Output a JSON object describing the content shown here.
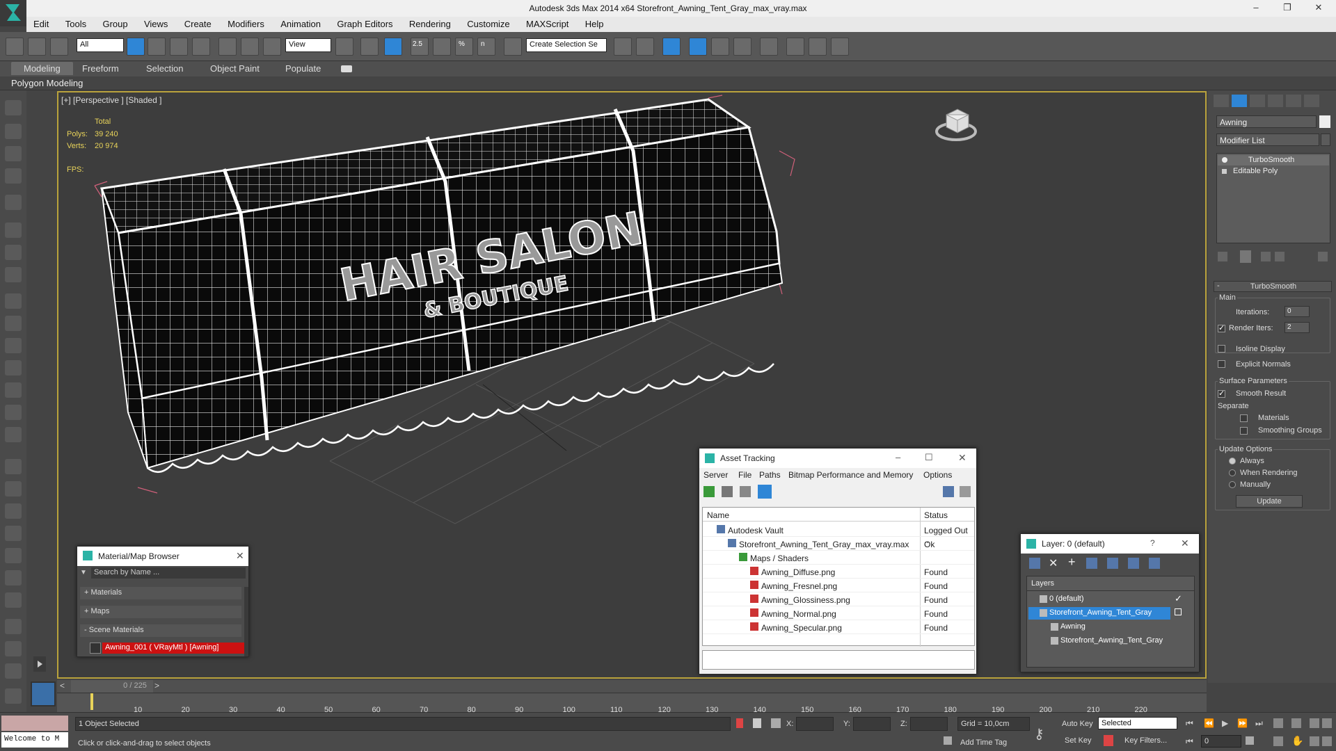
{
  "window": {
    "title": "Autodesk 3ds Max  2014 x64     Storefront_Awning_Tent_Gray_max_vray.max",
    "controls": [
      "–",
      "❐",
      "✕"
    ]
  },
  "menu": [
    "Edit",
    "Tools",
    "Group",
    "Views",
    "Create",
    "Modifiers",
    "Animation",
    "Graph Editors",
    "Rendering",
    "Customize",
    "MAXScript",
    "Help"
  ],
  "toolbar": {
    "filter_value": "All",
    "view_value": "View",
    "selection_set_placeholder": "Create Selection Se",
    "snap_labels": [
      "2.5",
      "%",
      "n"
    ]
  },
  "ribbon": {
    "tabs": [
      "Modeling",
      "Freeform",
      "Selection",
      "Object Paint",
      "Populate"
    ],
    "panel_label": "Polygon Modeling"
  },
  "viewport": {
    "label": "[+] [Perspective ] [Shaded ]",
    "stats_header": "Total",
    "polys_label": "Polys:",
    "polys_value": "39 240",
    "verts_label": "Verts:",
    "verts_value": "20 974",
    "fps_label": "FPS:",
    "sign_line1": "HAIR SALON",
    "sign_line2": "& BOUTIQUE"
  },
  "command_panel": {
    "object_name": "Awning",
    "modifier_list_label": "Modifier List",
    "stack": [
      "TurboSmooth",
      "Editable Poly"
    ],
    "rollout_title": "TurboSmooth",
    "main_group": "Main",
    "iterations_label": "Iterations:",
    "iterations_value": "0",
    "render_iters_label": "Render Iters:",
    "render_iters_value": "2",
    "render_iters_checked": true,
    "isoline_label": "Isoline Display",
    "explicit_normals_label": "Explicit Normals",
    "surface_params_group": "Surface Parameters",
    "smooth_result_label": "Smooth Result",
    "separate_label": "Separate",
    "materials_label": "Materials",
    "smoothing_groups_label": "Smoothing Groups",
    "update_options_group": "Update Options",
    "always_label": "Always",
    "when_rendering_label": "When Rendering",
    "manually_label": "Manually",
    "update_button": "Update"
  },
  "material_browser": {
    "title": "Material/Map Browser",
    "search_placeholder": "Search by Name ...",
    "sections": [
      "+ Materials",
      "+ Maps",
      "- Scene Materials"
    ],
    "scene_material": "Awning_001 ( VRayMtl ) [Awning]"
  },
  "asset_tracking": {
    "title": "Asset Tracking",
    "menus": [
      "Server",
      "File",
      "Paths",
      "Bitmap Performance and Memory",
      "Options"
    ],
    "columns": [
      "Name",
      "Status"
    ],
    "rows": [
      {
        "name": "Autodesk Vault",
        "status": "Logged Out ..",
        "indent": 1
      },
      {
        "name": "Storefront_Awning_Tent_Gray_max_vray.max",
        "status": "Ok",
        "indent": 2
      },
      {
        "name": "Maps / Shaders",
        "status": "",
        "indent": 3
      },
      {
        "name": "Awning_Diffuse.png",
        "status": "Found",
        "indent": 4
      },
      {
        "name": "Awning_Fresnel.png",
        "status": "Found",
        "indent": 4
      },
      {
        "name": "Awning_Glossiness.png",
        "status": "Found",
        "indent": 4
      },
      {
        "name": "Awning_Normal.png",
        "status": "Found",
        "indent": 4
      },
      {
        "name": "Awning_Specular.png",
        "status": "Found",
        "indent": 4
      }
    ]
  },
  "layer_dialog": {
    "title": "Layer: 0 (default)",
    "help": "?",
    "header": "Layers",
    "items": [
      {
        "name": "0 (default)",
        "selected": false,
        "indent": 1
      },
      {
        "name": "Storefront_Awning_Tent_Gray",
        "selected": true,
        "indent": 1
      },
      {
        "name": "Awning",
        "selected": false,
        "indent": 2
      },
      {
        "name": "Storefront_Awning_Tent_Gray",
        "selected": false,
        "indent": 2
      }
    ]
  },
  "timeline": {
    "frame_label": "0 / 225",
    "ticks": [
      "10",
      "20",
      "30",
      "40",
      "50",
      "60",
      "70",
      "80",
      "90",
      "100",
      "110",
      "120",
      "130",
      "140",
      "150",
      "160",
      "170",
      "180",
      "190",
      "200",
      "210",
      "220"
    ]
  },
  "status": {
    "welcome": "Welcome to M",
    "selected_text": "1 Object Selected",
    "prompt": "Click or click-and-drag to select objects",
    "x_label": "X:",
    "y_label": "Y:",
    "z_label": "Z:",
    "grid": "Grid = 10,0cm",
    "add_time_tag": "Add Time Tag",
    "auto_key": "Auto Key",
    "set_key": "Set Key",
    "key_mode_value": "Selected",
    "key_filters": "Key Filters...",
    "frame_value": "0"
  },
  "colors": {
    "viewport_border": "#b9a23b",
    "selection_blue": "#2f86d6",
    "material_red": "#cc1111",
    "stats_yellow": "#e8d35a"
  }
}
